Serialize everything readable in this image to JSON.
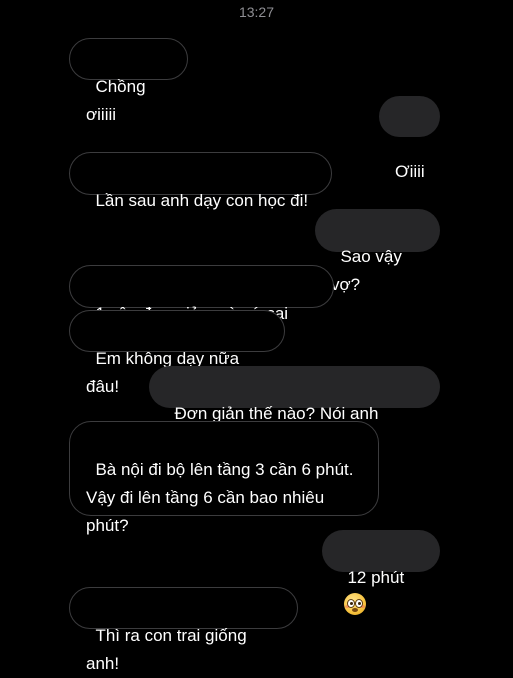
{
  "chat": {
    "timestamp": "13:27",
    "messages": [
      {
        "from": "them",
        "text": "Chồng ơiiiii"
      },
      {
        "from": "me",
        "text": "Ơiiii"
      },
      {
        "from": "them",
        "text": "Lần sau anh dạy con học đi!"
      },
      {
        "from": "me",
        "text": "Sao vậy vợ?"
      },
      {
        "from": "them",
        "text": "1 câu đơn giản mà cứ sai hoài"
      },
      {
        "from": "them",
        "text": "Em không dạy nữa đâu!"
      },
      {
        "from": "me",
        "text": "Đơn giản thế nào? Nói anh nghe!"
      },
      {
        "from": "them",
        "text": "Bà nội đi bộ lên tầng 3 cần 6 phút.\nVậy đi lên tầng 6 cần bao nhiêu\nphút?"
      },
      {
        "from": "me",
        "text": "12 phút",
        "emoji": "flushed-face-icon"
      },
      {
        "from": "them",
        "text": "Thì ra con trai giống anh!"
      }
    ]
  }
}
